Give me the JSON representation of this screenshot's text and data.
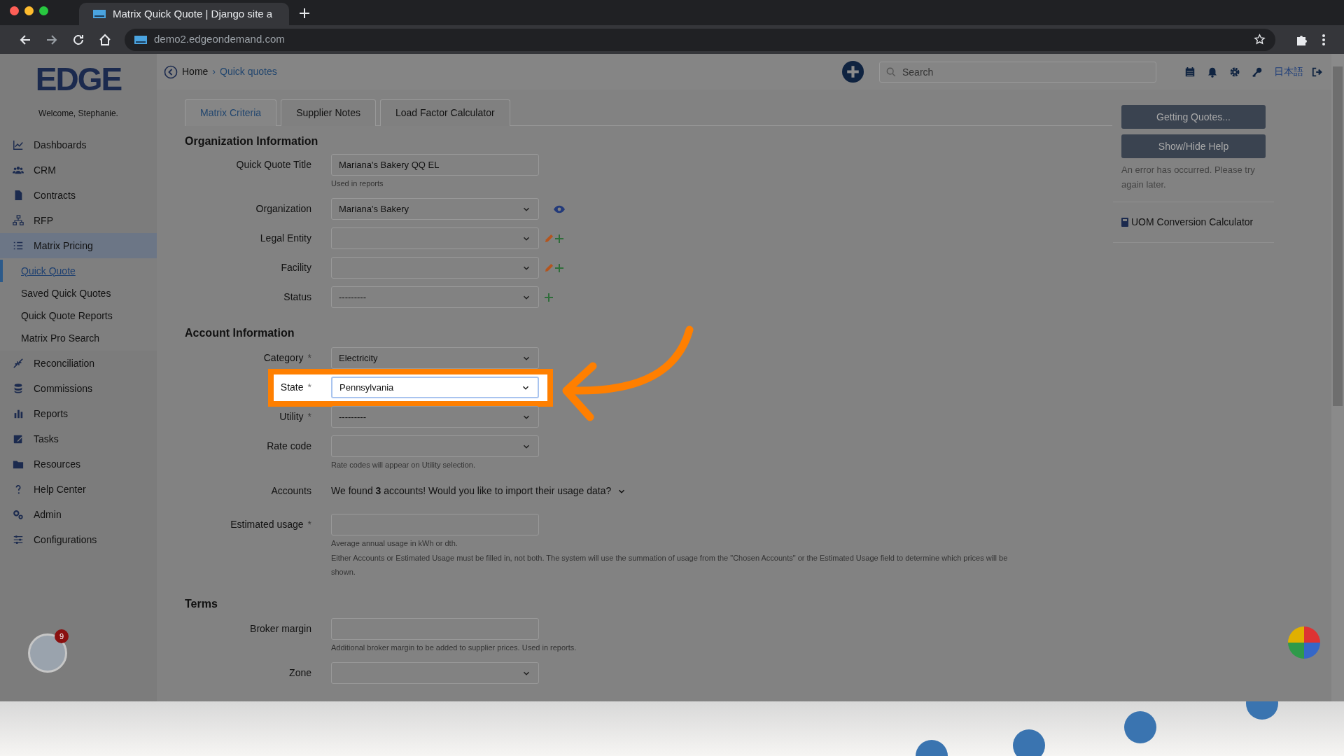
{
  "browser": {
    "tab_title": "Matrix Quick Quote | Django site a",
    "url": "demo2.edgeondemand.com"
  },
  "header": {
    "breadcrumbs": [
      "Home",
      "›",
      "Quick quotes"
    ],
    "search": {
      "placeholder": "Search"
    },
    "language": "日本語"
  },
  "sidebar": {
    "logo": "EDGE",
    "welcome": "Welcome, Stephanie.",
    "items": [
      {
        "label": "Dashboards",
        "selected": false
      },
      {
        "label": "CRM",
        "selected": false
      },
      {
        "label": "Contracts",
        "selected": false
      },
      {
        "label": "RFP",
        "selected": false
      },
      {
        "label": "Matrix Pricing",
        "selected": true,
        "children": [
          {
            "label": "Quick Quote",
            "selected": true
          },
          {
            "label": "Saved Quick Quotes",
            "selected": false
          },
          {
            "label": "Quick Quote Reports",
            "selected": false
          },
          {
            "label": "Matrix Pro Search",
            "selected": false
          }
        ]
      },
      {
        "label": "Reconciliation",
        "selected": false
      },
      {
        "label": "Commissions",
        "selected": false
      },
      {
        "label": "Reports",
        "selected": false
      },
      {
        "label": "Tasks",
        "selected": false
      },
      {
        "label": "Resources",
        "selected": false
      },
      {
        "label": "Help Center",
        "selected": false
      },
      {
        "label": "Admin",
        "selected": false
      },
      {
        "label": "Configurations",
        "selected": false
      }
    ],
    "badge": {
      "count": "9"
    }
  },
  "tabs": [
    {
      "label": "Matrix Criteria",
      "selected": true
    },
    {
      "label": "Supplier Notes",
      "selected": false
    },
    {
      "label": "Load Factor Calculator",
      "selected": false
    }
  ],
  "sections": [
    {
      "title": "Organization Information",
      "fields": [
        {
          "label": "Quick Quote Title",
          "kind": "text",
          "value": "Mariana's Bakery QQ EL",
          "hints": [
            "Used in reports"
          ]
        },
        {
          "label": "Organization",
          "kind": "select",
          "value": "Mariana's Bakery",
          "can_view": true
        },
        {
          "label": "Legal Entity",
          "kind": "select",
          "can_edit": true,
          "can_add": true
        },
        {
          "label": "Facility",
          "kind": "select",
          "can_edit": true,
          "can_add": true
        },
        {
          "label": "Status",
          "kind": "select",
          "value": "---------",
          "can_add": true
        }
      ]
    },
    {
      "title": "Account Information",
      "fields": [
        {
          "label": "Category",
          "kind": "select",
          "value": "Electricity",
          "required_mark": "*"
        },
        {
          "label": "State",
          "kind": "select",
          "value": "Pennsylvania",
          "required_mark": "*",
          "highlighted": true
        },
        {
          "label": "Utility",
          "kind": "select",
          "value": "---------",
          "required_mark": "*"
        },
        {
          "label": "Rate code",
          "kind": "select",
          "hints": [
            "Rate codes will appear on Utility selection."
          ]
        },
        {
          "label": "Accounts",
          "kind": "message",
          "value": "We found **3** accounts! Would you like to import their usage data?"
        },
        {
          "label": "Estimated usage",
          "kind": "text",
          "required_mark": "*",
          "hints": [
            "Average annual usage in kWh or dth.",
            "Either Accounts or Estimated Usage must be filled in, not both. The system will use the summation of usage from the \"Chosen Accounts\" or the Estimated Usage field to determine which prices will be shown."
          ]
        }
      ]
    },
    {
      "title": "Terms",
      "fields": [
        {
          "label": "Broker margin",
          "kind": "text",
          "hints": [
            "Additional broker margin to be added to supplier prices. Used in reports."
          ]
        },
        {
          "label": "Zone",
          "kind": "select"
        }
      ]
    }
  ],
  "right_panel": {
    "buttons": [
      "Getting Quotes...",
      "Show/Hide Help"
    ],
    "error": "An error has occurred. Please try again later.",
    "link": "UOM Conversion Calculator"
  }
}
